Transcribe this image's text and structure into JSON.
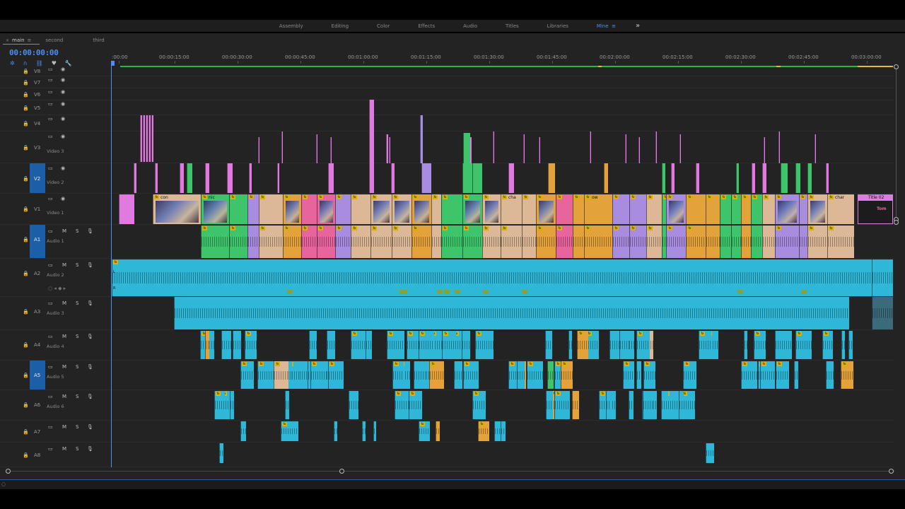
{
  "workspace_tabs": [
    "Assembly",
    "Editing",
    "Color",
    "Effects",
    "Audio",
    "Titles",
    "Libraries",
    "Mine"
  ],
  "active_workspace": "Mine",
  "workspace_menu_icon": "≡",
  "overflow_icon": "»",
  "sequence_tabs": [
    "main",
    "second",
    "third"
  ],
  "active_sequence": "main",
  "timecode": "00:00:00:00",
  "ruler_labels": [
    ":00:00",
    "00:00:15:00",
    "00:00:30:00",
    "00:00:45:00",
    "00:01:00:00",
    "00:01:15:00",
    "00:01:30:00",
    "00:01:45:00",
    "00:02:00:00",
    "00:02:15:00",
    "00:02:30:00",
    "00:02:45:00",
    "00:03:00:00"
  ],
  "video_tracks": [
    {
      "id": "V8",
      "name": "",
      "targeted": false
    },
    {
      "id": "V7",
      "name": "",
      "targeted": false
    },
    {
      "id": "V6",
      "name": "",
      "targeted": false
    },
    {
      "id": "V5",
      "name": "",
      "targeted": false
    },
    {
      "id": "V4",
      "name": "",
      "targeted": false
    },
    {
      "id": "V3",
      "name": "Video 3",
      "targeted": false
    },
    {
      "id": "V2",
      "name": "Video 2",
      "targeted": true
    },
    {
      "id": "V1",
      "name": "Video 1",
      "targeted": false
    }
  ],
  "audio_tracks": [
    {
      "id": "A1",
      "name": "Audio 1",
      "targeted": true
    },
    {
      "id": "A2",
      "name": "Audio 2",
      "targeted": false
    },
    {
      "id": "A3",
      "name": "Audio 3",
      "targeted": false
    },
    {
      "id": "A4",
      "name": "Audio 4",
      "targeted": false
    },
    {
      "id": "A5",
      "name": "Audio 5",
      "targeted": true
    },
    {
      "id": "A6",
      "name": "Audio 6",
      "targeted": false
    },
    {
      "id": "A7",
      "name": "",
      "targeted": false
    },
    {
      "id": "A8",
      "name": "",
      "targeted": false
    }
  ],
  "track_buttons": {
    "mute": "M",
    "solo": "S"
  },
  "clip_labels": {
    "v1_a": "con",
    "v1_b": "nic",
    "v1_c": "cha",
    "v1_d": "ow",
    "v1_e": "char",
    "title": "Title 02"
  },
  "clip_text": {
    "title_preview": "Tom"
  },
  "channel_labels": {
    "left": "L",
    "right": "R"
  },
  "colors": {
    "accent": "#4b8ff2",
    "video_pink": "#e07ae0",
    "green": "#3ec46a",
    "peach": "#dcb896",
    "purple": "#a88ce0",
    "magenta": "#e8649c",
    "orange": "#e3a23a",
    "audio_cyan": "#2fb7d8",
    "workbar": "#2fb24a"
  }
}
